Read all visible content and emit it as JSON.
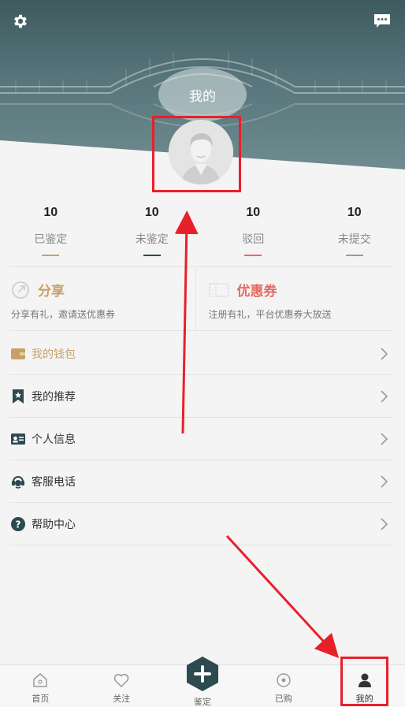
{
  "header": {
    "title": "我的",
    "settings_icon": "gear-icon",
    "message_icon": "chat-bubble-icon"
  },
  "stats": [
    {
      "count": "10",
      "label": "已鉴定",
      "color": "#c9a068"
    },
    {
      "count": "10",
      "label": "未鉴定",
      "color": "#2c4a4f"
    },
    {
      "count": "10",
      "label": "驳回",
      "color": "#e46a62"
    },
    {
      "count": "10",
      "label": "未提交",
      "color": "#9a9a9a"
    }
  ],
  "promo": {
    "share": {
      "title": "分享",
      "subtitle": "分享有礼，邀请送优惠券",
      "color": "#c9a068"
    },
    "coupon": {
      "title": "优惠券",
      "subtitle": "注册有礼，平台优惠券大放送",
      "color": "#e46a62"
    }
  },
  "menu": [
    {
      "label": "我的钱包",
      "icon": "wallet-icon",
      "color": "#c9a068"
    },
    {
      "label": "我的推荐",
      "icon": "bookmark-star-icon",
      "color": "#333333"
    },
    {
      "label": "个人信息",
      "icon": "id-card-icon",
      "color": "#333333"
    },
    {
      "label": "客服电话",
      "icon": "headset-icon",
      "color": "#333333"
    },
    {
      "label": "帮助中心",
      "icon": "help-circle-icon",
      "color": "#333333"
    }
  ],
  "tabbar": [
    {
      "label": "首页",
      "icon": "home-icon"
    },
    {
      "label": "关注",
      "icon": "heart-icon"
    },
    {
      "label": "鉴定",
      "icon": "plus-hexagon-icon"
    },
    {
      "label": "已购",
      "icon": "purchased-icon"
    },
    {
      "label": "我的",
      "icon": "person-icon",
      "active": true
    }
  ],
  "colors": {
    "accent_dark": "#2c4a4f",
    "gold": "#c9a068",
    "red": "#e46a62",
    "highlight": "#e8202a"
  }
}
